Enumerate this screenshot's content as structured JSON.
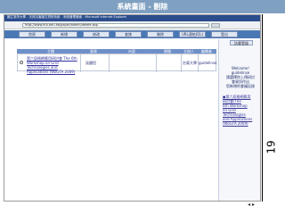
{
  "slide": {
    "title": "系統畫面 - 刪除",
    "page_number": "19"
  },
  "window": {
    "title": "國立臺灣大學 - 天然災害論文資訊系統 - 系統管理畫面 - Microsoft Internet Explorer"
  },
  "address": {
    "url": "http://www.ntu.edu.tw/paper/admin/delete.asp"
  },
  "nav": {
    "items": [
      {
        "label": "首頁"
      },
      {
        "label": "新增"
      },
      {
        "label": "修改"
      },
      {
        "label": "查詢"
      },
      {
        "label": "刪除"
      },
      {
        "label": "URL連結(DL)"
      },
      {
        "label": "登出"
      }
    ]
  },
  "sidebar": {
    "top_button": "訪客登錄",
    "welcome_lines": [
      "Welcome!",
      "guidelinse",
      "請選擇你上傳研討",
      "會資訊作出",
      "您新增的會議記錄"
    ],
    "link_lines": [
      "●第六屆格網應用",
      "研討會/The",
      "6th Workshop",
      "on Grid",
      "Technologies",
      "and Applications",
      "(WoGTA 2009)"
    ]
  },
  "table": {
    "headers": [
      "主題",
      "發表",
      "內容",
      "期間",
      "主辦人",
      "編輯者"
    ],
    "rows": [
      {
        "title": "第六屆格網應用研討會 The 6th Workshop on Grid Technologies and Applications (WoGTA 2009)",
        "author": "吳國恆",
        "content": "",
        "period": "",
        "host": "台東大學",
        "editor": "guidelinse"
      }
    ]
  },
  "footer": {
    "icons": "◂ ▸"
  }
}
